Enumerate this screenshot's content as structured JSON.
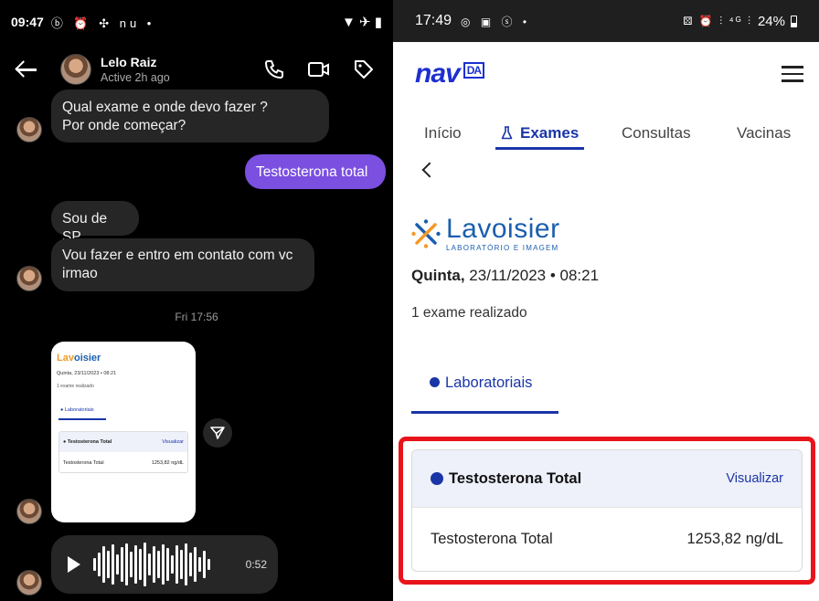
{
  "left": {
    "status": {
      "time": "09:47",
      "icons": "ⓑ ⏰ ✣ nu •",
      "right_icons": "▼ ✈ ▮"
    },
    "header": {
      "name": "Lelo Raiz",
      "active": "Active 2h ago"
    },
    "messages": {
      "m1": "Qual exame e onde devo fazer ?\nPor onde começar?",
      "m2": "Testosterona total",
      "m3": "Sou de SP",
      "m4": "Vou fazer e entro em contato com vc\nirmao"
    },
    "timestamp": "Fri 17:56",
    "shared": {
      "logo_a": "Lav",
      "logo_b": "oisier",
      "date": "Quinta, 23/11/2023 • 08:21",
      "count": "1 exame realizado",
      "tab": "● Laboratoriais",
      "head": "● Testosterona Total",
      "view": "Visualizar",
      "row_label": "Testosterona Total",
      "row_value": "1253,82 ng/dL"
    },
    "voice": {
      "duration": "0:52"
    }
  },
  "right": {
    "status": {
      "time": "17:49",
      "icons": "◎ ▣ ⓢ •",
      "battery": "24%",
      "right_icons": "⚄ ⏰ ⫶ ⁴ᴳ ⫶"
    },
    "brand": {
      "name": "nav",
      "badge": "DA"
    },
    "tabs": [
      "Início",
      "Exames",
      "Consultas",
      "Vacinas"
    ],
    "lab": {
      "name": "Lavoisier",
      "subtitle": "LABORATÓRIO E IMAGEM"
    },
    "date_day": "Quinta,",
    "date_rest": " 23/11/2023 • 08:21",
    "count": "1 exame realizado",
    "section_tab": "Laboratoriais",
    "exam": {
      "title": "Testosterona Total",
      "view_label": "Visualizar",
      "row_label": "Testosterona Total",
      "row_value": "1253,82 ng/dL"
    },
    "colors": {
      "accent": "#1a35a8",
      "highlight": "#e8141b",
      "chat_bubble_me": "#7b4fe0"
    }
  }
}
